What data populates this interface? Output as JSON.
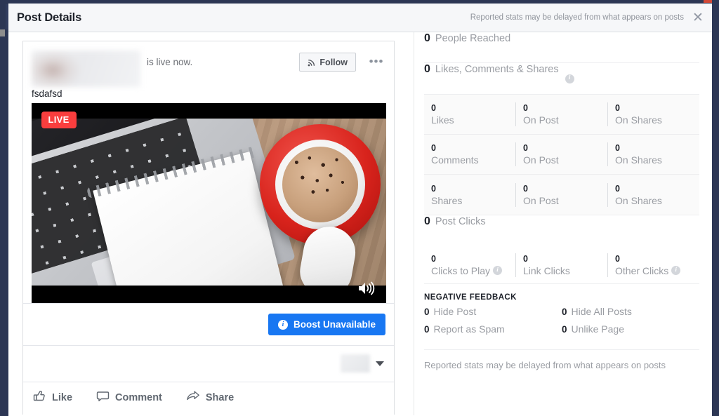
{
  "header": {
    "title": "Post Details",
    "note": "Reported stats may be delayed from what appears on posts",
    "close_icon": "close-icon",
    "close_glyph": "✕"
  },
  "post": {
    "author_name": "",
    "status_text": "is live now.",
    "message": "fsdafsd",
    "follow_label": "Follow",
    "follow_icon": "rss-icon",
    "more_icon": "ellipsis-icon",
    "more_glyph": "•••",
    "live_badge": "LIVE",
    "volume_icon": "volume-icon",
    "media_alt": "laptop keyboard with notepad, red coffee cup and white mouse on wooden desk",
    "boost_label": "Boost Unavailable",
    "boost_info_glyph": "i",
    "audience_caret_icon": "chevron-down-icon",
    "actions": [
      {
        "label": "Like",
        "icon": "thumbs-up-icon"
      },
      {
        "label": "Comment",
        "icon": "comment-bubble-icon"
      },
      {
        "label": "Share",
        "icon": "share-arrow-icon"
      }
    ]
  },
  "insights": {
    "reach": {
      "value": "0",
      "label": "People Reached"
    },
    "engagement": {
      "value": "0",
      "label": "Likes, Comments & Shares",
      "info": true
    },
    "breakdown": [
      {
        "primary": {
          "value": "0",
          "label": "Likes"
        },
        "on_post": {
          "value": "0",
          "label": "On Post"
        },
        "on_shares": {
          "value": "0",
          "label": "On Shares"
        }
      },
      {
        "primary": {
          "value": "0",
          "label": "Comments"
        },
        "on_post": {
          "value": "0",
          "label": "On Post"
        },
        "on_shares": {
          "value": "0",
          "label": "On Shares"
        }
      },
      {
        "primary": {
          "value": "0",
          "label": "Shares"
        },
        "on_post": {
          "value": "0",
          "label": "On Post"
        },
        "on_shares": {
          "value": "0",
          "label": "On Shares"
        }
      }
    ],
    "post_clicks": {
      "value": "0",
      "label": "Post Clicks"
    },
    "clicks_breakdown": [
      {
        "value": "0",
        "label": "Clicks to Play",
        "info": true
      },
      {
        "value": "0",
        "label": "Link Clicks",
        "info": false
      },
      {
        "value": "0",
        "label": "Other Clicks",
        "info": true
      }
    ],
    "negative_feedback": {
      "title": "NEGATIVE FEEDBACK",
      "items": [
        {
          "value": "0",
          "label": "Hide Post"
        },
        {
          "value": "0",
          "label": "Hide All Posts"
        },
        {
          "value": "0",
          "label": "Report as Spam"
        },
        {
          "value": "0",
          "label": "Unlike Page"
        }
      ]
    },
    "footer_note": "Reported stats may be delayed from what appears on posts"
  },
  "colors": {
    "brand_blue": "#1877f2",
    "chrome_navy": "#2c3654",
    "live_red": "#fa3e3e",
    "text_primary": "#1d2129",
    "text_muted": "#9a9da3"
  }
}
